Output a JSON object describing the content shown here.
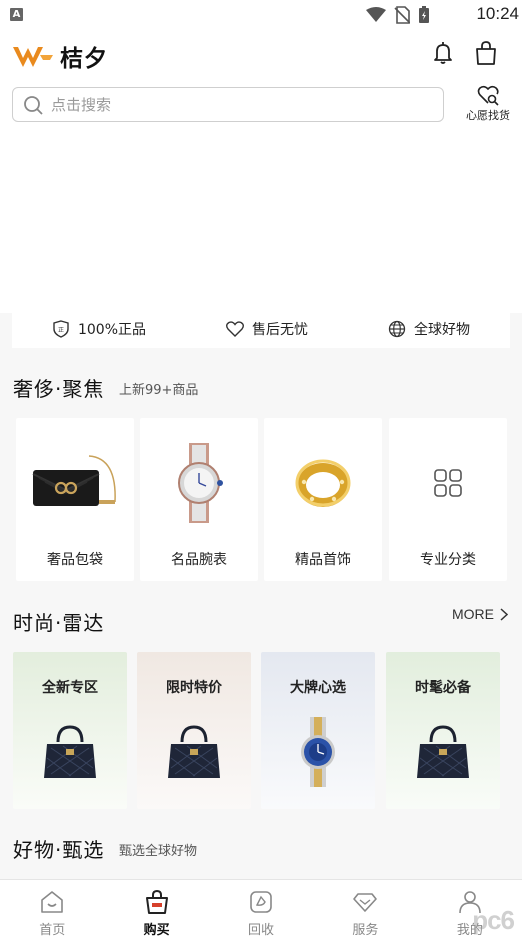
{
  "status_bar": {
    "app_icon_letter": "A",
    "time": "10:24"
  },
  "header": {
    "brand": "桔夕",
    "search_placeholder": "点击搜索",
    "wish_label": "心愿找货"
  },
  "guarantees": [
    {
      "icon": "shield-icon",
      "label": "100%正品"
    },
    {
      "icon": "heart-icon",
      "label": "售后无忧"
    },
    {
      "icon": "globe-icon",
      "label": "全球好物"
    }
  ],
  "luxury": {
    "title": "奢侈·聚焦",
    "subtitle": "上新99+商品",
    "categories": [
      {
        "label": "奢品包袋",
        "icon": "handbag-image"
      },
      {
        "label": "名品腕表",
        "icon": "watch-image"
      },
      {
        "label": "精品首饰",
        "icon": "ring-image"
      },
      {
        "label": "专业分类",
        "icon": "grid-icon"
      }
    ]
  },
  "fashion": {
    "title": "时尚·雷达",
    "more": "MORE",
    "cards": [
      {
        "title": "全新专区",
        "icon": "handbag-image",
        "bg": "#e7efe2"
      },
      {
        "title": "限时特价",
        "icon": "handbag-image",
        "bg": "#f1ebe6"
      },
      {
        "title": "大牌心选",
        "icon": "watch-image",
        "bg": "#e7eaf1"
      },
      {
        "title": "时髦必备",
        "icon": "handbag-image",
        "bg": "#e6efe3"
      }
    ]
  },
  "selection": {
    "title": "好物·甄选",
    "subtitle": "甄选全球好物"
  },
  "tabs": [
    {
      "label": "首页",
      "icon": "home-icon"
    },
    {
      "label": "购买",
      "icon": "bag-icon",
      "active": true
    },
    {
      "label": "回收",
      "icon": "recycle-icon"
    },
    {
      "label": "服务",
      "icon": "diamond-icon"
    },
    {
      "label": "我的",
      "icon": "profile-icon"
    }
  ],
  "watermark": "pc6",
  "colors": {
    "brand_orange": "#e98a1e",
    "accent_red": "#d6402b"
  }
}
